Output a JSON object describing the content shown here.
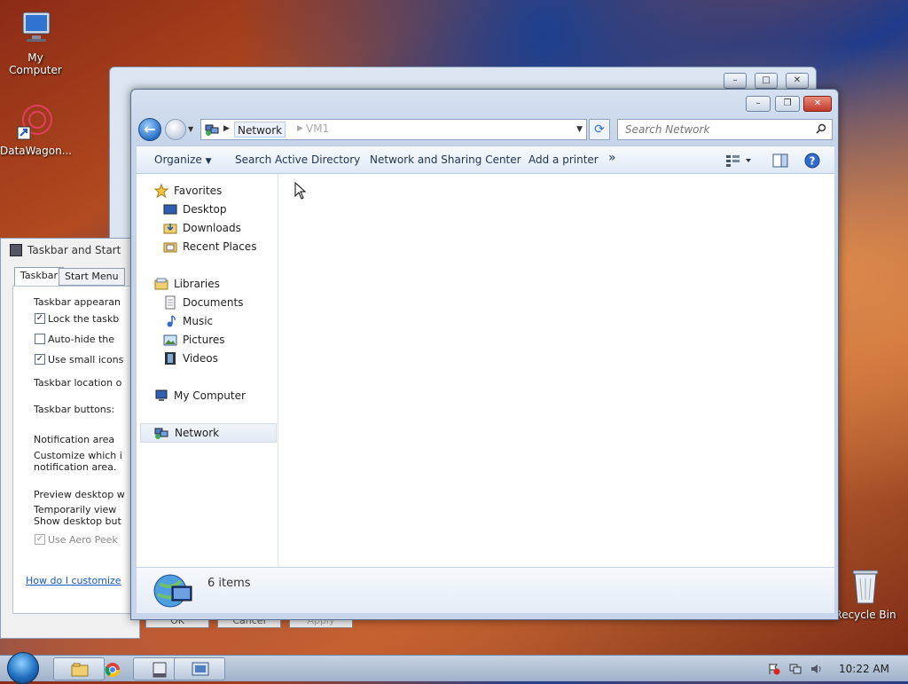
{
  "desktop": {
    "icons": [
      {
        "label": "My Computer"
      },
      {
        "label": "DataWagon..."
      },
      {
        "label": "Recycle Bin"
      }
    ]
  },
  "dialog": {
    "title": "Taskbar and Start",
    "tabs": [
      "Taskbar",
      "Start Menu"
    ],
    "lines": {
      "appearance": "Taskbar appearan",
      "lock": "Lock the taskb",
      "autohide": "Auto-hide the",
      "smallicons": "Use small icons",
      "location": "Taskbar location o",
      "buttons": "Taskbar buttons:",
      "notif_title": "Notification area",
      "notif_desc1": "Customize which i",
      "notif_desc2": "notification area.",
      "preview_title": "Preview desktop w",
      "preview_desc1": "Temporarily view",
      "preview_desc2": "Show desktop but",
      "aero": "Use Aero Peek"
    },
    "link": "How do I customize",
    "buttons": [
      "OK",
      "Cancel",
      "Apply"
    ]
  },
  "explorer": {
    "address": {
      "crumb": "Network",
      "sub": "VM1"
    },
    "search": {
      "placeholder": "Search Network"
    },
    "toolbar": {
      "organize": "Organize",
      "search_ad": "Search Active Directory",
      "nsc": "Network and Sharing Center",
      "add_printer": "Add a printer",
      "more": "»"
    },
    "nav": {
      "favorites": "Favorites",
      "desktop": "Desktop",
      "downloads": "Downloads",
      "recent": "Recent Places",
      "libraries": "Libraries",
      "documents": "Documents",
      "music": "Music",
      "pictures": "Pictures",
      "videos": "Videos",
      "computer": "My Computer",
      "network": "Network"
    },
    "details": {
      "count": "6 items"
    }
  },
  "taskbar": {
    "time": "10:22 AM"
  }
}
